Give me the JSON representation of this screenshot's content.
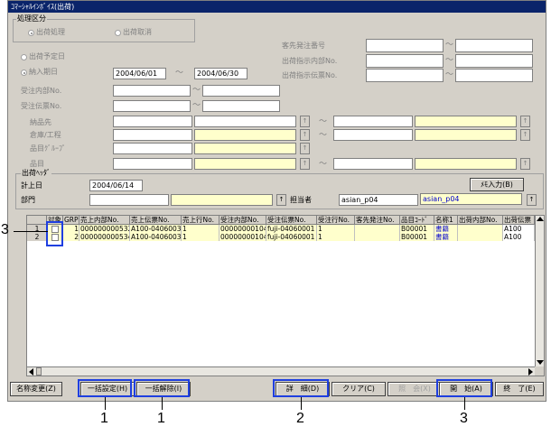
{
  "window": {
    "title": "ｺﾏｰｼｬﾙｲﾝﾎﾞｲｽ(出荷)"
  },
  "process_group": {
    "label": "処理区分",
    "options": [
      {
        "label": "出荷処理",
        "selected": true
      },
      {
        "label": "出荷取消",
        "selected": false
      }
    ]
  },
  "date_mode": {
    "options": [
      {
        "label": "出荷予定日",
        "selected": false
      },
      {
        "label": "納入期日",
        "selected": true
      }
    ],
    "from": "2004/06/01",
    "to": "2004/06/30"
  },
  "fields": {
    "customer_order_no": "客先発注番号",
    "shipping_instruction_internal_no": "出荷指示内部No.",
    "shipping_instruction_slip_no": "出荷指示伝票No.",
    "order_internal_no": "受注内部No.",
    "order_slip_no": "受注伝票No.",
    "delivery_to": "納品先",
    "warehouse_process": "倉庫/工程",
    "item_group": "品目ｸﾞﾙｰﾌﾟ",
    "item": "品目"
  },
  "shipping_header": {
    "label": "出荷ﾍｯﾀﾞ",
    "post_date_label": "計上日",
    "post_date": "2004/06/14",
    "department_label": "部門",
    "person_label": "担当者",
    "person_code": "asian_p04",
    "person_name": "asian_p04",
    "memo_button": "ﾒﾓ入力(B)"
  },
  "grid": {
    "columns": [
      "対象",
      "GRP",
      "売上内部No.",
      "売上伝票No.",
      "売上行No.",
      "受注内部No.",
      "受注伝票No.",
      "受注行No.",
      "客先発注No.",
      "品目ｺｰﾄﾞ",
      "名称1",
      "出荷内部No.",
      "出荷伝票"
    ],
    "rows": [
      {
        "num": "1",
        "grp": "1",
        "sales_internal": "000000000532",
        "sales_slip": "A100-04060030",
        "sales_line": "1",
        "order_internal": "000000001041",
        "order_slip": "fuji-04060001",
        "order_line": "1",
        "cust_po": "",
        "item_code": "B00001",
        "name1": "書籍",
        "ship_internal": "",
        "ship_slip": "A100"
      },
      {
        "num": "2",
        "grp": "2",
        "sales_internal": "000000000534",
        "sales_slip": "A100-04060032",
        "sales_line": "1",
        "order_internal": "000000001041",
        "order_slip": "fuji-04060001",
        "order_line": "1",
        "cust_po": "",
        "item_code": "B00001",
        "name1": "書籍",
        "ship_internal": "",
        "ship_slip": "A100"
      }
    ]
  },
  "buttons": {
    "rename": "名称変更(Z)",
    "bulk_set": "一括設定(H)",
    "bulk_clear": "一括解除(I)",
    "detail": "詳　細(D)",
    "clear": "クリア(C)",
    "inquiry": "照　会(X)",
    "start": "開　始(A)",
    "end": "終　了(E)"
  },
  "small_button_glyph": "↑",
  "range_sep": "～",
  "callouts": {
    "c1a": "1",
    "c1b": "1",
    "c2": "2",
    "c3a": "3",
    "c3b": "3"
  },
  "colors": {
    "title_bar": "#0a246a",
    "highlight": "#1f3fe0",
    "required_field": "#ffffcc"
  }
}
